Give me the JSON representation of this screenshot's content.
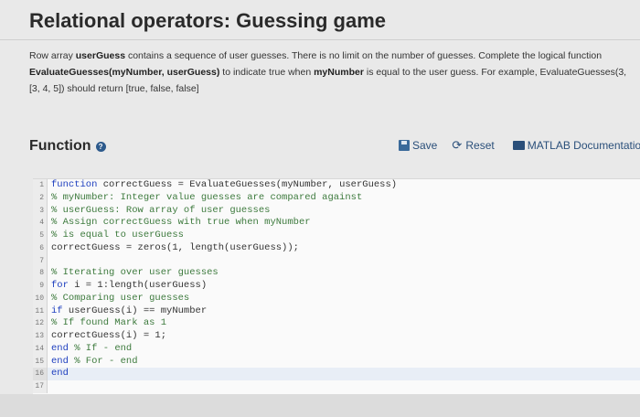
{
  "title": "Relational operators: Guessing game",
  "description": {
    "p1": "Row array ",
    "b1": "userGuess",
    "p2": " contains a sequence of user guesses.  There is no limit on the number of guesses.  Complete the logical function ",
    "b2": "EvaluateGuesses(myNumber, userGuess)",
    "p3": " to indicate true when ",
    "b3": "myNumber",
    "p4": " is equal to the user guess.  For example, EvaluateGuesses(3, [3, 4, 5]) should return [true, false, false]"
  },
  "function_header": {
    "label": "Function",
    "help_icon": "?"
  },
  "toolbar": {
    "save_label": "Save",
    "reset_label": "Reset",
    "doc_label": "MATLAB Documentation"
  },
  "code_lines": [
    {
      "n": "1",
      "kw": "function",
      "rest": " correctGuess = EvaluateGuesses(myNumber, userGuess)"
    },
    {
      "n": "2",
      "cm": "% myNumber: Integer value guesses are compared against"
    },
    {
      "n": "3",
      "cm": "% userGuess: Row array of user guesses"
    },
    {
      "n": "4",
      "cm": "% Assign correctGuess with true when myNumber"
    },
    {
      "n": "5",
      "cm": "% is equal to userGuess"
    },
    {
      "n": "6",
      "rest": "correctGuess = zeros(1, length(userGuess));"
    },
    {
      "n": "7",
      "rest": ""
    },
    {
      "n": "8",
      "cm": "% Iterating over user guesses"
    },
    {
      "n": "9",
      "kw": "for",
      "rest": " i = 1:length(userGuess)"
    },
    {
      "n": "10",
      "cm": "% Comparing user guesses"
    },
    {
      "n": "11",
      "kw": "if",
      "rest": " userGuess(i) == myNumber"
    },
    {
      "n": "12",
      "cm": "% If found Mark as 1"
    },
    {
      "n": "13",
      "rest": "correctGuess(i) = 1;"
    },
    {
      "n": "14",
      "kw": "end",
      "cm": " % If - end"
    },
    {
      "n": "15",
      "kw": "end",
      "cm": " % For - end"
    },
    {
      "n": "16",
      "kw": "end",
      "active": true
    },
    {
      "n": "17",
      "rest": ""
    }
  ]
}
